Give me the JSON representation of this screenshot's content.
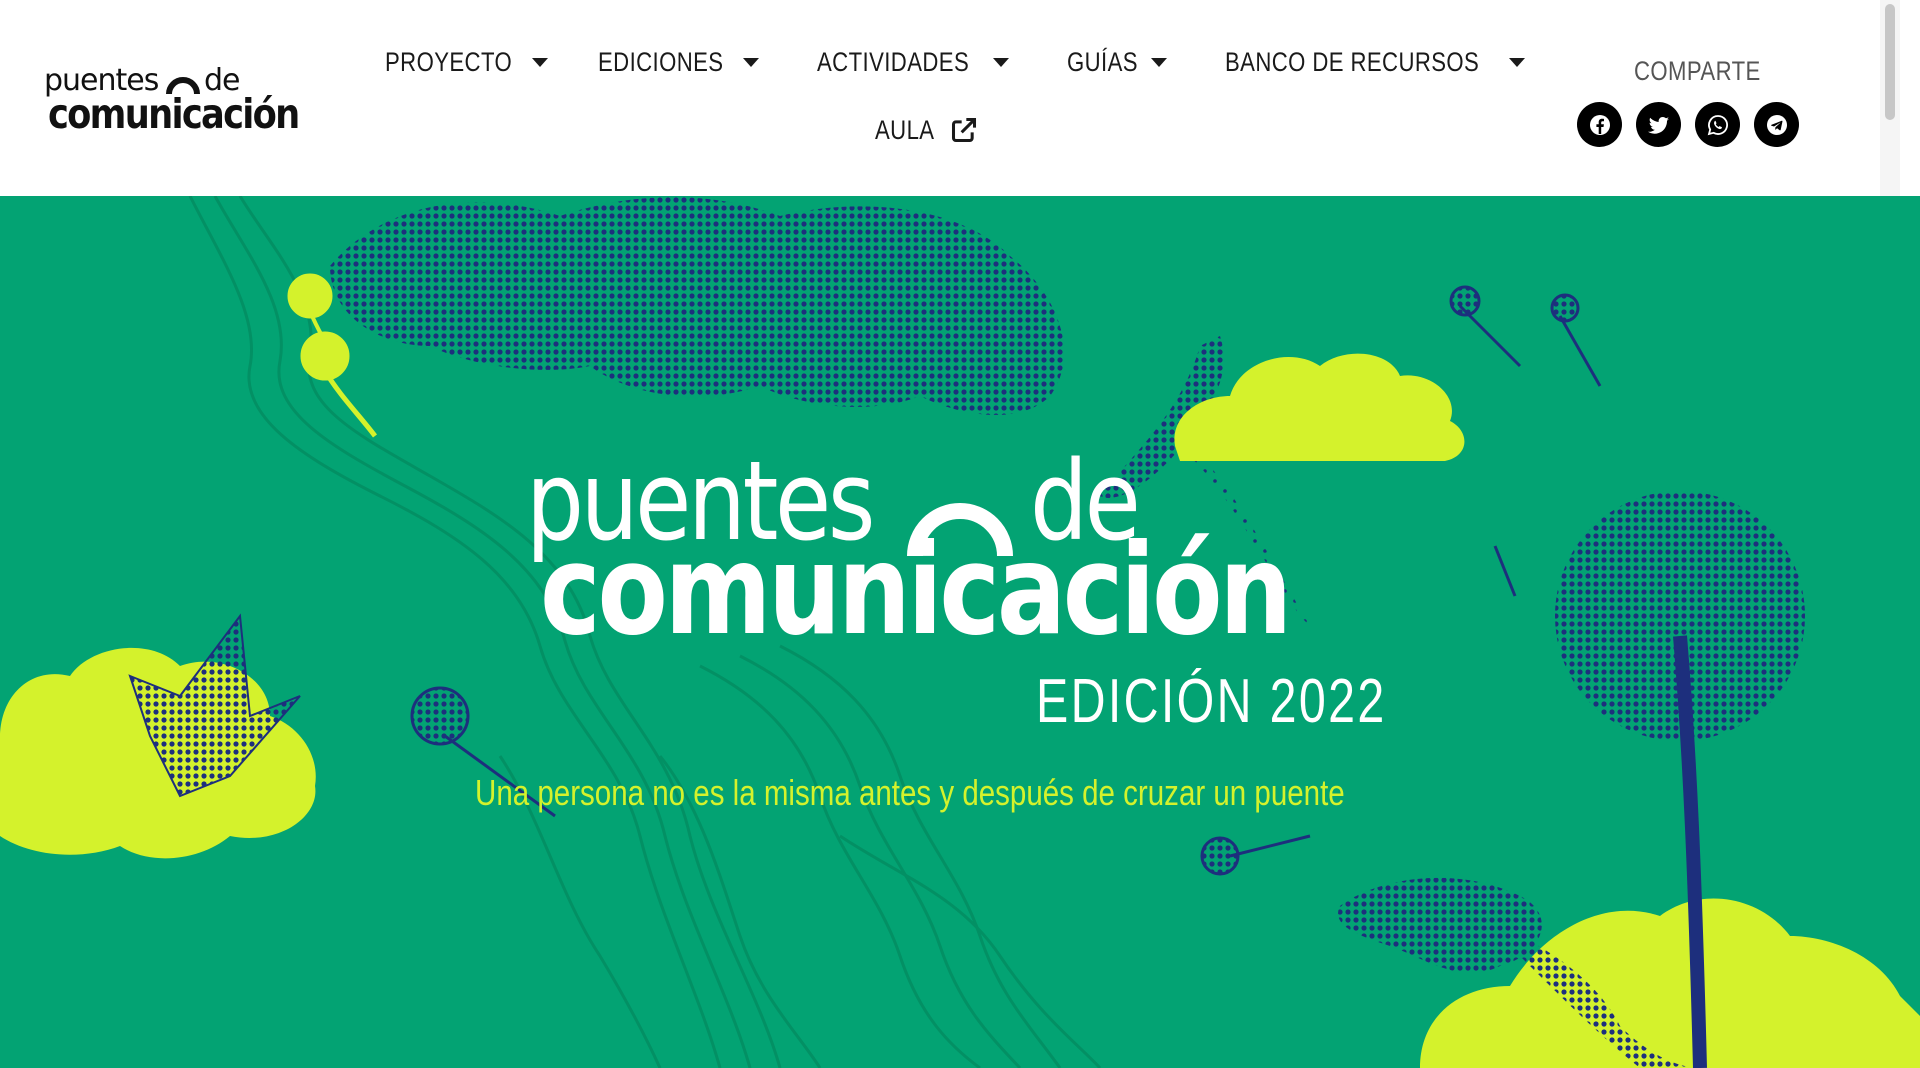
{
  "logo": {
    "line1_word1": "puentes",
    "line1_word2": "de",
    "line2": "comunicación"
  },
  "nav": {
    "items": [
      {
        "label": "PROYECTO",
        "has_dropdown": true
      },
      {
        "label": "EDICIONES",
        "has_dropdown": true
      },
      {
        "label": "ACTIVIDADES",
        "has_dropdown": true
      },
      {
        "label": "GUÍAS",
        "has_dropdown": true
      },
      {
        "label": "BANCO DE RECURSOS",
        "has_dropdown": true
      },
      {
        "label": "AULA",
        "icon": "external-link-icon"
      }
    ]
  },
  "share": {
    "title": "COMPARTE",
    "icons": [
      "facebook-icon",
      "twitter-icon",
      "whatsapp-icon",
      "telegram-icon"
    ]
  },
  "hero": {
    "title_word1": "puentes",
    "title_word2": "de",
    "title_line2": "comunicación",
    "edition": "EDICIÓN 2022",
    "tagline": "Una persona no es la misma antes y después de cruzar un puente"
  },
  "colors": {
    "hero_bg": "#03a373",
    "accent_lime": "#d4f22c",
    "navy": "#1a2a78",
    "text_dark": "#1a1a1a"
  }
}
